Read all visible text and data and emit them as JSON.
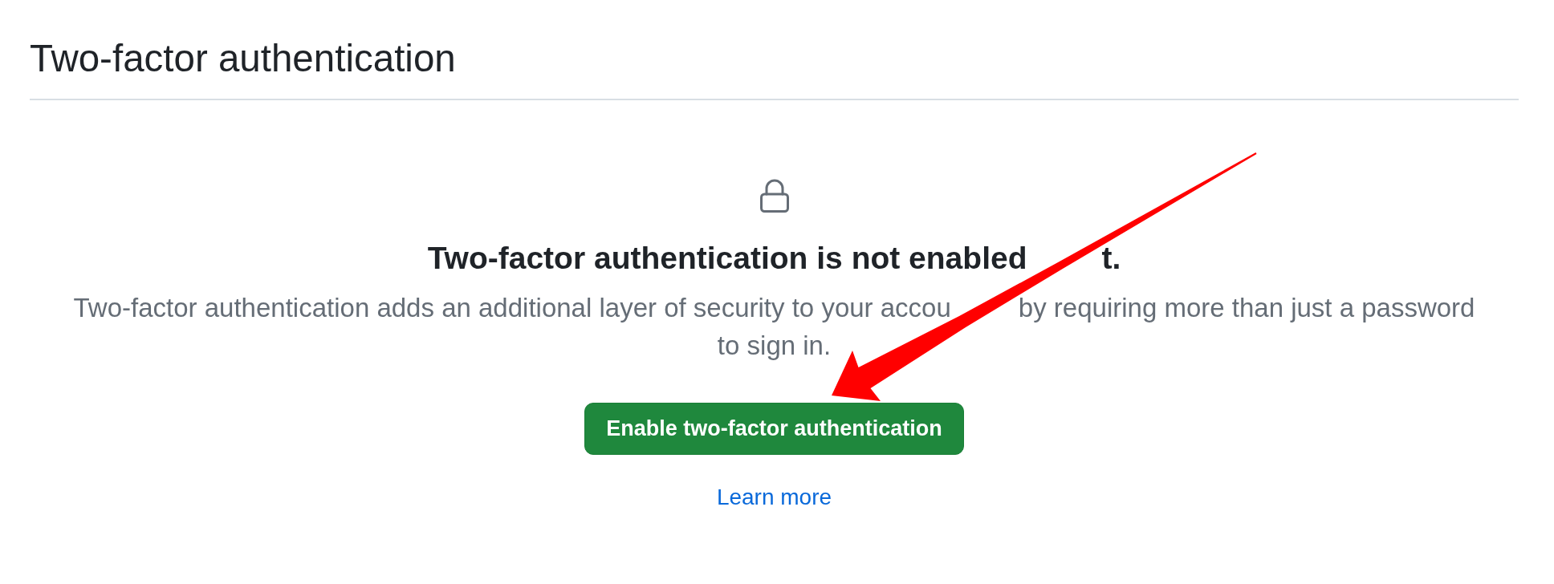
{
  "page": {
    "title": "Two-factor authentication"
  },
  "blankslate": {
    "heading": {
      "fragments": [
        "Two-factor authentication is not enabled",
        "t."
      ]
    },
    "description_lines": [
      {
        "fragments": [
          "Two-factor authentication adds an additional layer of security to your accou",
          "by requiring more than just a password"
        ]
      },
      {
        "fragments": [
          "to sign in."
        ]
      }
    ],
    "button": "Enable two-factor authentication",
    "link": "Learn more"
  }
}
